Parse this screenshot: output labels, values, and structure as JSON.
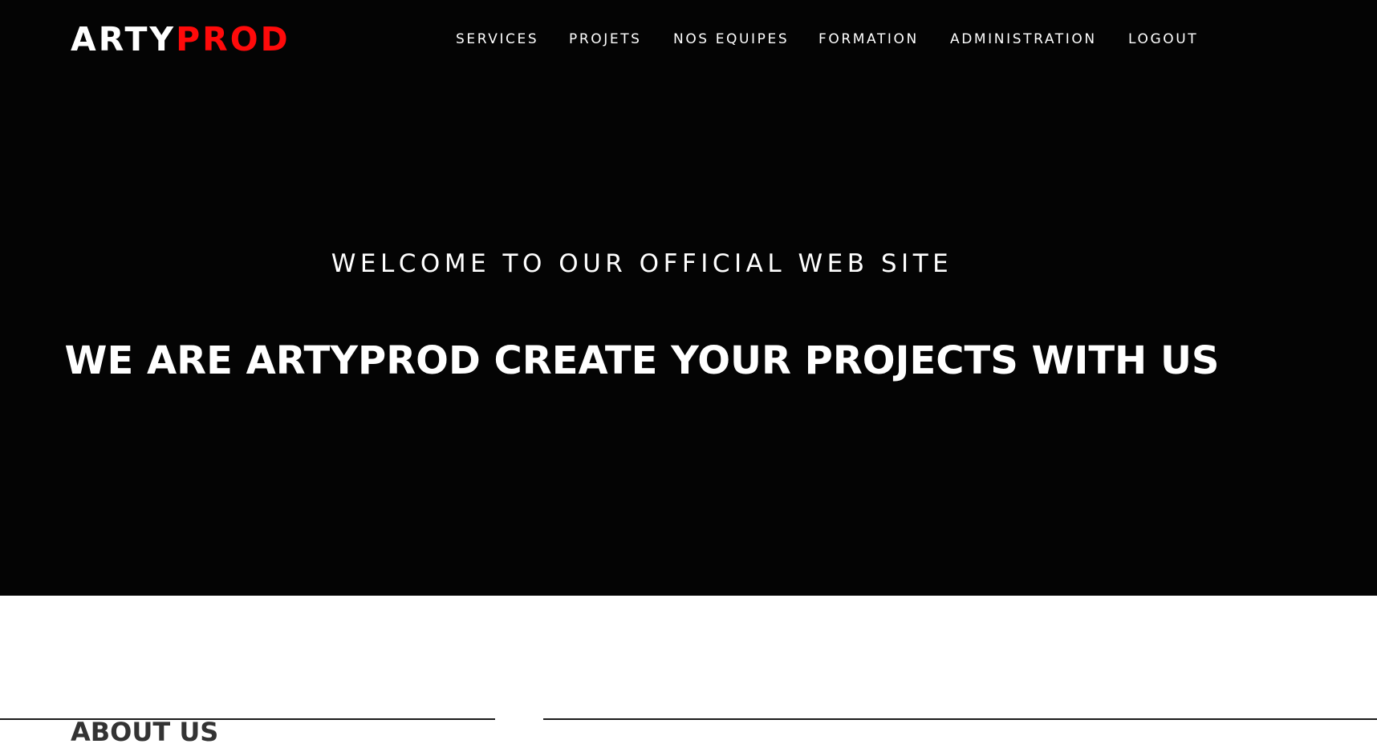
{
  "brand": {
    "name_part_1": "ARTY",
    "name_part_2": "PROD",
    "accent_color": "#ff0a0a"
  },
  "nav": {
    "items": [
      {
        "label": "SERVICES"
      },
      {
        "label": "PROJETS"
      },
      {
        "label": "NOS EQUIPES"
      },
      {
        "label": "FORMATION"
      },
      {
        "label": "ADMINISTRATION"
      },
      {
        "label": "LOGOUT"
      }
    ]
  },
  "hero": {
    "subtitle": "WELCOME TO OUR OFFICIAL WEB SITE",
    "headline": "WE ARE ARTYPROD CREATE YOUR PROJECTS WITH US",
    "background_color": "#040404"
  },
  "about": {
    "title": "ABOUT US"
  }
}
